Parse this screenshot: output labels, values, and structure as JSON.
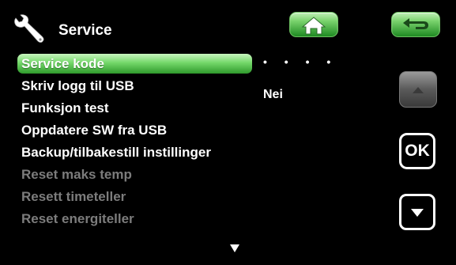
{
  "header": {
    "title": "Service",
    "wrench_icon": "wrench-icon",
    "home_icon": "home-icon",
    "back_icon": "back-arrow-icon"
  },
  "menu": {
    "items": [
      {
        "label": "Service kode",
        "state": "selected"
      },
      {
        "label": "Skriv logg til USB",
        "state": "enabled"
      },
      {
        "label": "Funksjon test",
        "state": "enabled"
      },
      {
        "label": "Oppdatere SW fra USB",
        "state": "enabled"
      },
      {
        "label": "Backup/tilbakestill instillinger",
        "state": "enabled"
      },
      {
        "label": "Reset maks temp",
        "state": "disabled"
      },
      {
        "label": "Resett timeteller",
        "state": "disabled"
      },
      {
        "label": "Reset energiteller",
        "state": "disabled"
      }
    ]
  },
  "values": {
    "service_code": "• • • •",
    "usb_log": "Nei"
  },
  "nav": {
    "ok_label": "OK",
    "up_icon": "chevron-up-icon",
    "down_icon": "chevron-down-icon",
    "more_icon": "scroll-more-down-icon"
  },
  "colors": {
    "background": "#000000",
    "accent_green": "#4fc44a",
    "disabled_text": "#7c7c7c",
    "text": "#ffffff"
  }
}
